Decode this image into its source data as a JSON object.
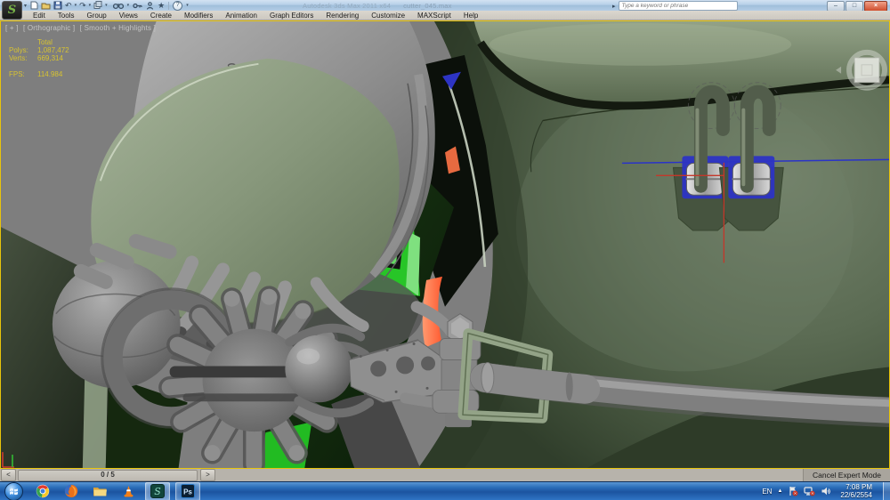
{
  "titlebar": {
    "app_logo": "S",
    "app_title": "Autodesk 3ds Max 2011 x64",
    "file_name": "cutter_045.max",
    "search_placeholder": "Type a keyword or phrase",
    "window_buttons": {
      "minimize": "–",
      "maximize": "□",
      "close": "×"
    },
    "qat_icons": [
      "new-scene",
      "open-file",
      "save-file",
      "undo",
      "undo-dropdown",
      "redo",
      "redo-dropdown",
      "manage-scene",
      "manage-dropdown"
    ],
    "right_icons": [
      "search-expand",
      "search-binoculars",
      "sign-in-key",
      "communication-center",
      "favorites-star",
      "help"
    ]
  },
  "menu": {
    "items": [
      {
        "label": "Edit"
      },
      {
        "label": "Tools"
      },
      {
        "label": "Group"
      },
      {
        "label": "Views"
      },
      {
        "label": "Create"
      },
      {
        "label": "Modifiers"
      },
      {
        "label": "Animation"
      },
      {
        "label": "Graph Editors"
      },
      {
        "label": "Rendering"
      },
      {
        "label": "Customize"
      },
      {
        "label": "MAXScript"
      },
      {
        "label": "Help"
      }
    ]
  },
  "viewport": {
    "label_plus": "[ + ]",
    "label_view": "[ Orthographic ]",
    "label_shading": "[ Smooth + Highlights ]",
    "stats": {
      "header": "Total",
      "polys_label": "Polys:",
      "polys_value": "1,087,472",
      "verts_label": "Verts:",
      "verts_value": "669,314",
      "fps_label": "FPS:",
      "fps_value": "114.984"
    }
  },
  "statusbar": {
    "prev_frame": "<",
    "frame_display": "0 / 5",
    "next_frame": ">",
    "cancel_expert_mode": "Cancel Expert Mode"
  },
  "taskbar": {
    "apps": [
      "start-orb",
      "chrome",
      "firefox",
      "windows-explorer",
      "vlc",
      "3ds-max",
      "photoshop"
    ],
    "photoshop_label": "Ps",
    "tray": {
      "language": "EN",
      "hidden_icons": "▲",
      "time": "7:08 PM",
      "date": "22/6/2554",
      "icons": [
        "action-center-flag",
        "network-status",
        "volume"
      ]
    }
  },
  "palette": {
    "viewport_bg": "#7e7e7e",
    "active_border": "#e8c40a",
    "stats_text": "#d7c331",
    "label_text": "#c5c5c5",
    "bright_green": "#27c527",
    "selection_blue": "#2d34c4",
    "gizmo_red": "#c4372a",
    "orange_part": "#ff7446",
    "fuselage_green": "#5b6b53",
    "taskbar_blue": "#2a6db8",
    "titlebar_blue": "#b4cde6",
    "menu_bg": "#dbd7cf",
    "statusbar_bg": "#b7b3ab"
  }
}
